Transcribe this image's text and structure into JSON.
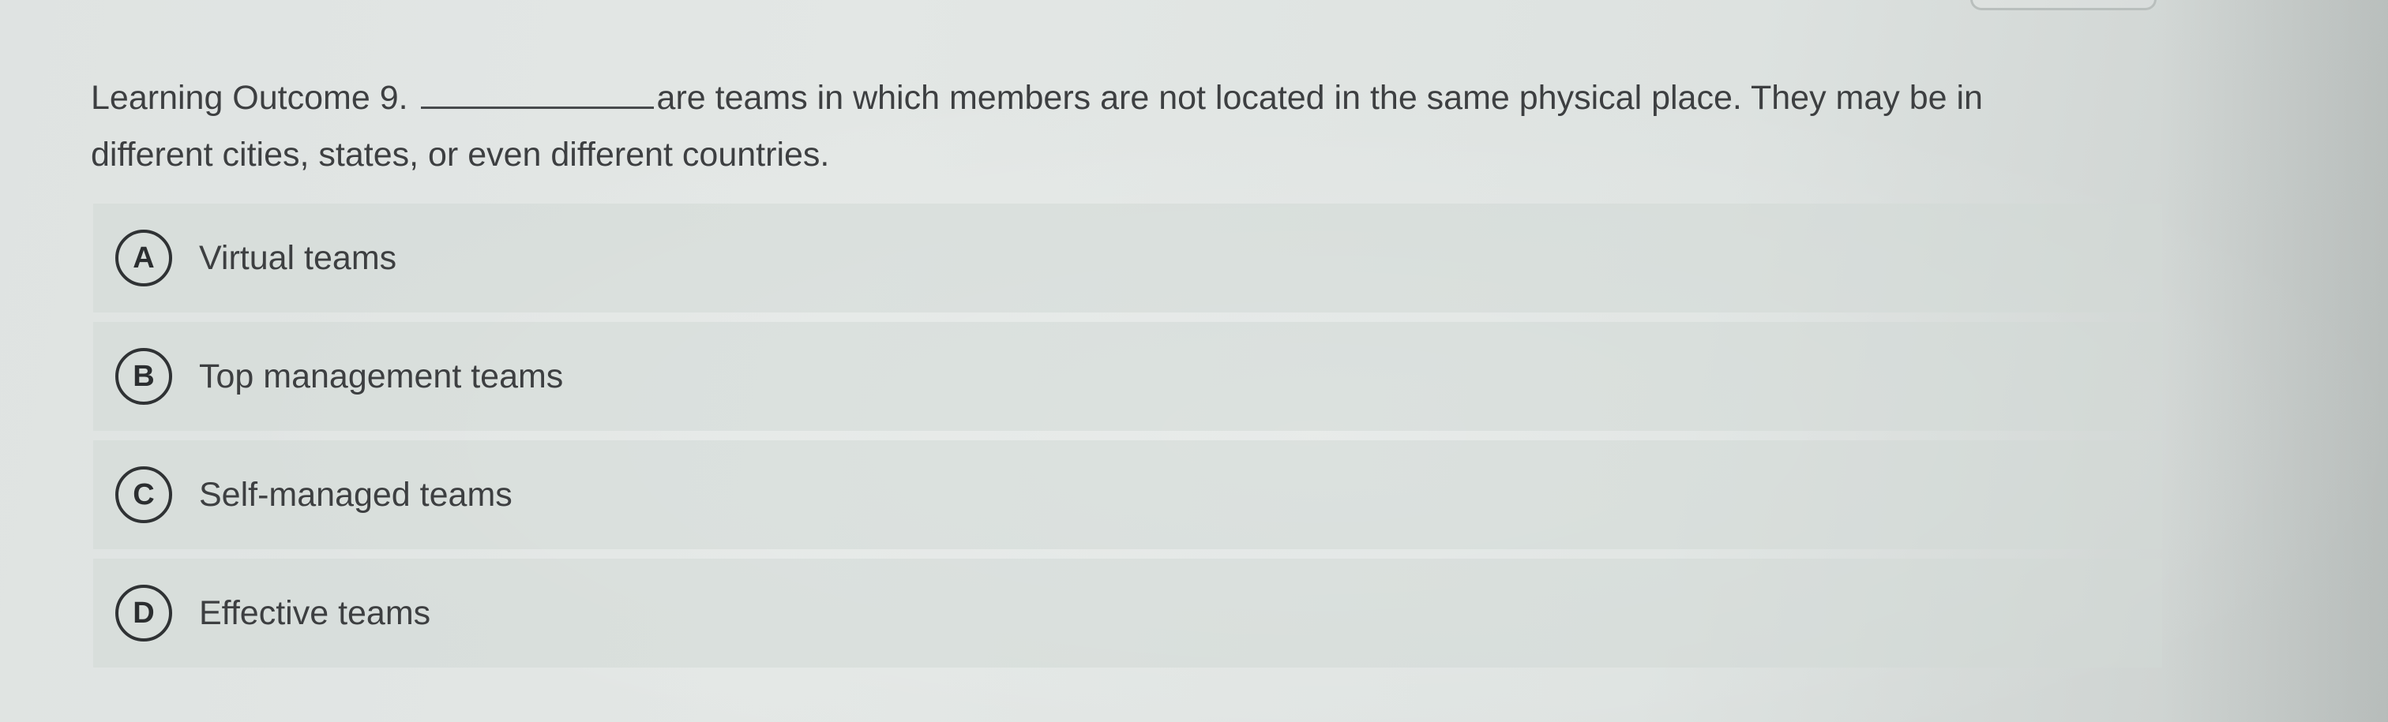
{
  "question": {
    "prefix": "Learning Outcome 9.",
    "text": "are teams in which members are not located in the same physical place. They may be in different cities, states, or even different countries."
  },
  "options": [
    {
      "letter": "A",
      "label": "Virtual teams"
    },
    {
      "letter": "B",
      "label": "Top management teams"
    },
    {
      "letter": "C",
      "label": "Self-managed teams"
    },
    {
      "letter": "D",
      "label": "Effective teams"
    }
  ]
}
